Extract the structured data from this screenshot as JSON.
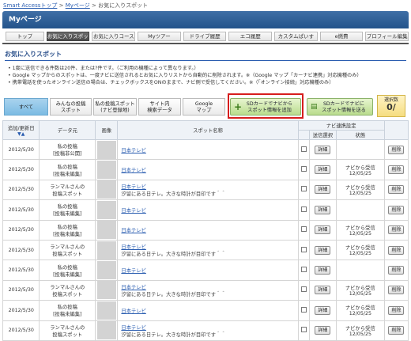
{
  "breadcrumb": {
    "items": [
      "Smart Accessトップ",
      "Myページ",
      "お気に入りスポット"
    ],
    "sep": ">"
  },
  "header": {
    "title": "Myページ"
  },
  "tabs": [
    {
      "label": "トップ",
      "active": false
    },
    {
      "label": "お気に入りスポット",
      "active": true
    },
    {
      "label": "お気に入りコース",
      "active": false
    },
    {
      "label": "Myツアー",
      "active": false
    },
    {
      "label": "ドライブ履歴",
      "active": false
    },
    {
      "label": "エコ履歴",
      "active": false
    },
    {
      "label": "カスタムぱいす",
      "active": false
    },
    {
      "label": "e燃費",
      "active": false
    },
    {
      "label": "プロフィール編集",
      "active": false
    }
  ],
  "section_title": "お気に入りスポット",
  "notes": [
    "1度に送信できる件数は20件、または?件です。（ご利用の機種によって異なります。）",
    "Google マップからのスポットは、一度ナビに送信されるとお気に入りリストから自動的に削除されます。※（Google マップ「カーナビ連携」対応機種のみ）",
    "携帯電話を使ったオンライン送信の場合は、チェックボックスをONのままで、ナビ側で受信してください。※（「オンライン接続」対応機種のみ）"
  ],
  "filter_tabs": [
    {
      "label": "すべて",
      "active": true
    },
    {
      "label": "みんなの投稿\nスポット",
      "active": false
    },
    {
      "label": "私の投稿スポット\n(ナビ登録地)",
      "active": false
    },
    {
      "label": "サイト内\n検索データ",
      "active": false
    },
    {
      "label": "Google\nマップ",
      "active": false
    }
  ],
  "sd_add_button": "SDカードでナビから\nスポット情報を追加",
  "sd_send_button": "SDカードでナビに\nスポット情報を送る",
  "selected": {
    "label": "選択数",
    "count": "0/"
  },
  "table": {
    "headers": {
      "date": "追加/更新日",
      "sort": "▼▲",
      "source": "データ元",
      "image": "画像",
      "spot": "スポット名称",
      "navi": "ナビ連携設定",
      "send": "送信選択",
      "status": "状態"
    },
    "detail_label": "詳細",
    "delete_label": "削除",
    "rows": [
      {
        "date": "2012/5/30",
        "source": "私の投稿\n[投稿非公開]",
        "name": "日本テレビ",
        "desc": "",
        "status": ""
      },
      {
        "date": "2012/5/30",
        "source": "私の投稿\n[投稿未編集]",
        "name": "日本テレビ",
        "desc": "",
        "status": "ナビから受信\n12/05/25"
      },
      {
        "date": "2012/5/30",
        "source": "ランマルさんの\n投稿スポット",
        "name": "日本テレビ",
        "desc": "汐留にある日テレ。大きな時計が目印です＾＾",
        "status": "ナビから受信\n12/05/25"
      },
      {
        "date": "2012/5/30",
        "source": "私の投稿\n[投稿未編集]",
        "name": "日本テレビ",
        "desc": "",
        "status": ""
      },
      {
        "date": "2012/5/30",
        "source": "私の投稿\n[投稿未編集]",
        "name": "日本テレビ",
        "desc": "",
        "status": "ナビから受信\n12/05/25"
      },
      {
        "date": "2012/5/30",
        "source": "ランマルさんの\n投稿スポット",
        "name": "日本テレビ",
        "desc": "汐留にある日テレ。大きな時計が目印です＾＾",
        "status": "ナビから受信\n12/05/25"
      },
      {
        "date": "2012/5/30",
        "source": "私の投稿\n[投稿未編集]",
        "name": "日本テレビ",
        "desc": "",
        "status": ""
      },
      {
        "date": "2012/5/30",
        "source": "ランマルさんの\n投稿スポット",
        "name": "日本テレビ",
        "desc": "汐留にある日テレ。大きな時計が目印です＾＾",
        "status": "ナビから受信\n12/05/25"
      },
      {
        "date": "2012/5/30",
        "source": "私の投稿\n[投稿未編集]",
        "name": "日本テレビ",
        "desc": "",
        "status": "ナビから受信\n12/05/25"
      },
      {
        "date": "2012/5/30",
        "source": "ランマルさんの\n投稿スポット",
        "name": "日本テレビ",
        "desc": "汐留にある日テレ。大きな時計が目印です＾＾",
        "status": "ナビから受信\n12/05/25"
      }
    ]
  }
}
